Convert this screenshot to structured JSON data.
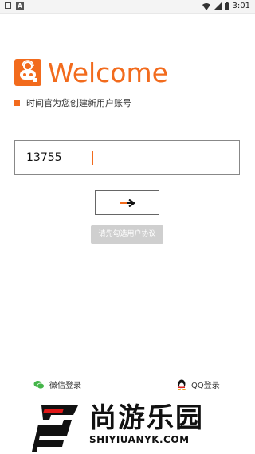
{
  "status_bar": {
    "time": "3:01"
  },
  "header": {
    "welcome": "Welcome",
    "subtitle": "时间官为您创建新用户账号"
  },
  "form": {
    "phone_value": "13755"
  },
  "buttons": {
    "next_arrow": "→",
    "agree_prompt": "请先勾选用户协议"
  },
  "social": {
    "wechat_label": "微信登录",
    "qq_label": "QQ登录"
  },
  "watermark": {
    "cn": "尚游乐园",
    "en": "SHIYIUANYK.COM"
  },
  "colors": {
    "accent": "#f26b1d",
    "disabled_button": "#cfcfcf",
    "wechat_green": "#44b549"
  }
}
